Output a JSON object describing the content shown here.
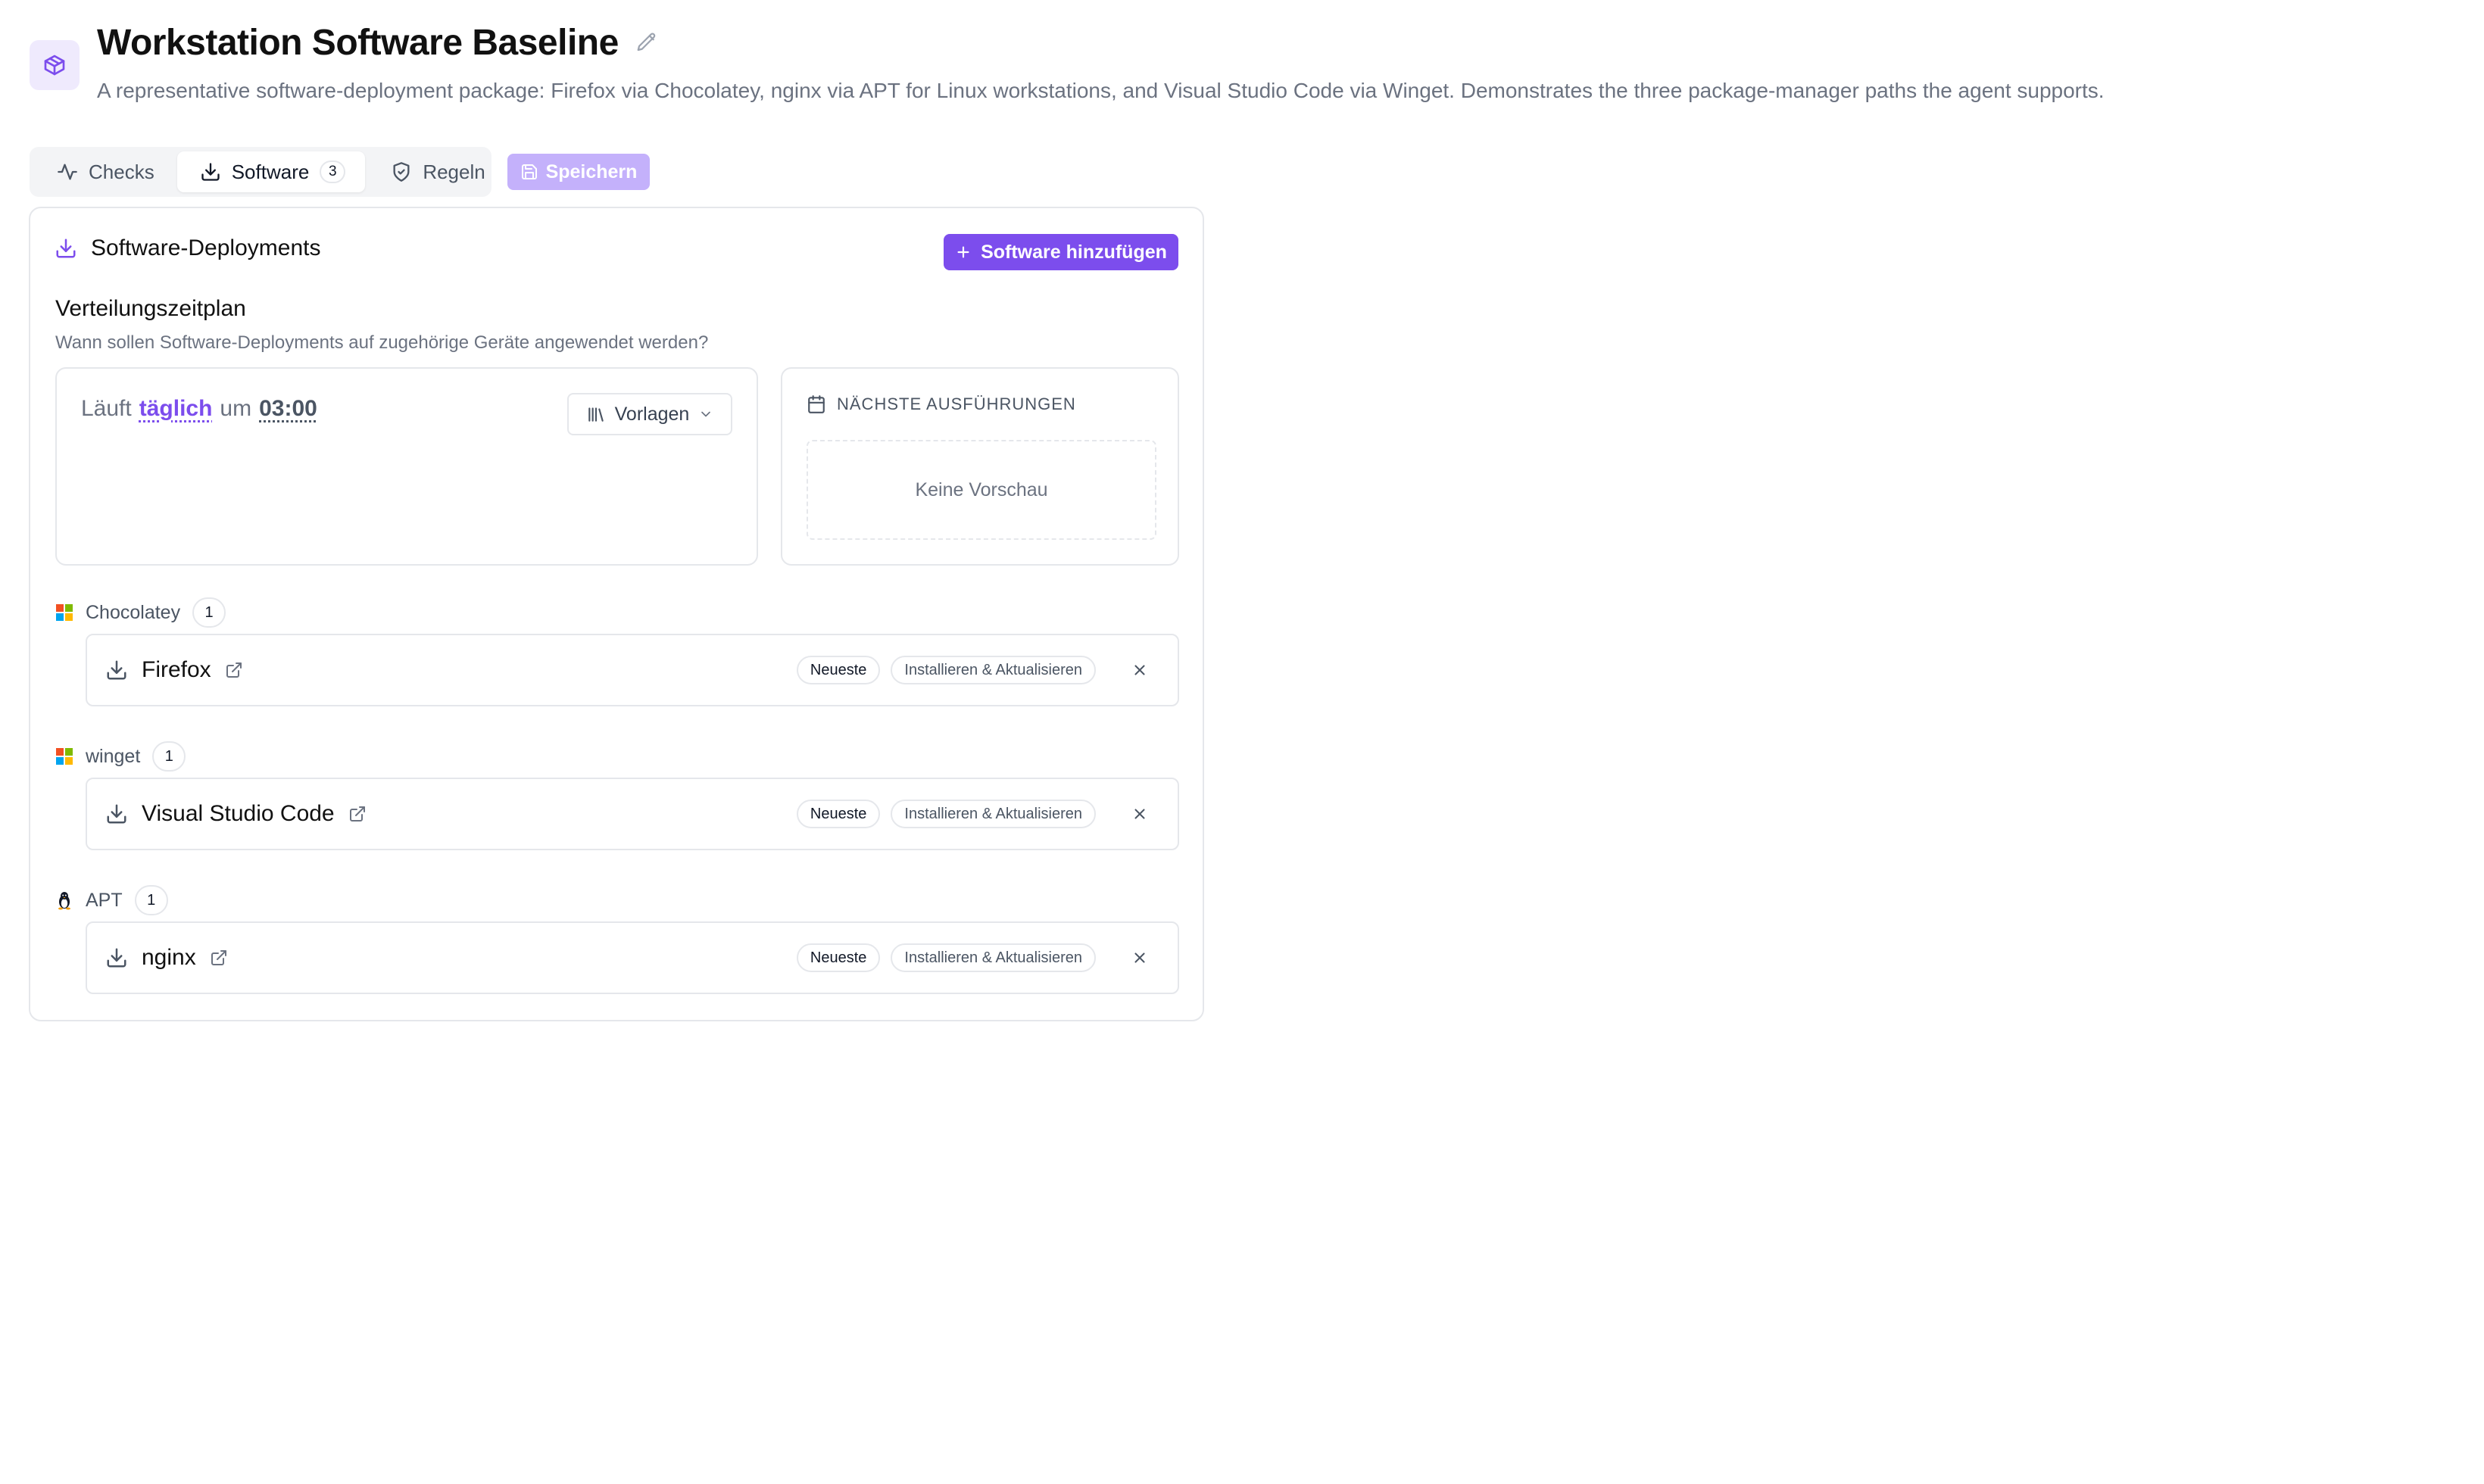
{
  "header": {
    "title": "Workstation Software Baseline",
    "description": "A representative software-deployment package: Firefox via Chocolatey, nginx via APT for Linux workstations, and Visual Studio Code via Winget. Demonstrates the three package-manager paths the agent supports."
  },
  "tabs": [
    {
      "label": "Checks",
      "icon": "activity-icon"
    },
    {
      "label": "Software",
      "icon": "download-icon",
      "count": "3",
      "active": true
    },
    {
      "label": "Regeln",
      "icon": "shield-icon"
    }
  ],
  "toolbar": {
    "save_label": "Speichern"
  },
  "panel": {
    "title": "Software-Deployments",
    "add_label": "Software hinzufügen"
  },
  "schedule": {
    "title": "Verteilungszeitplan",
    "subtitle": "Wann sollen Software-Deployments auf zugehörige Geräte angewendet werden?",
    "prefix": "Läuft",
    "frequency": "täglich",
    "connector": "um",
    "time": "03:00",
    "templates_label": "Vorlagen",
    "next_runs_title": "NÄCHSTE AUSFÜHRUNGEN",
    "no_preview": "Keine Vorschau"
  },
  "groups": [
    {
      "manager": "Chocolatey",
      "count": "1",
      "icon": "windows-icon",
      "items": [
        {
          "name": "Firefox",
          "version": "Neueste",
          "action": "Installieren & Aktualisieren"
        }
      ]
    },
    {
      "manager": "winget",
      "count": "1",
      "icon": "windows-icon",
      "items": [
        {
          "name": "Visual Studio Code",
          "version": "Neueste",
          "action": "Installieren & Aktualisieren"
        }
      ]
    },
    {
      "manager": "APT",
      "count": "1",
      "icon": "linux-icon",
      "items": [
        {
          "name": "nginx",
          "version": "Neueste",
          "action": "Installieren & Aktualisieren"
        }
      ]
    }
  ],
  "colors": {
    "accent": "#7c4ded",
    "accent_disabled": "#c4b1fb",
    "border": "#e5e7eb",
    "muted_text": "#6b7280"
  }
}
